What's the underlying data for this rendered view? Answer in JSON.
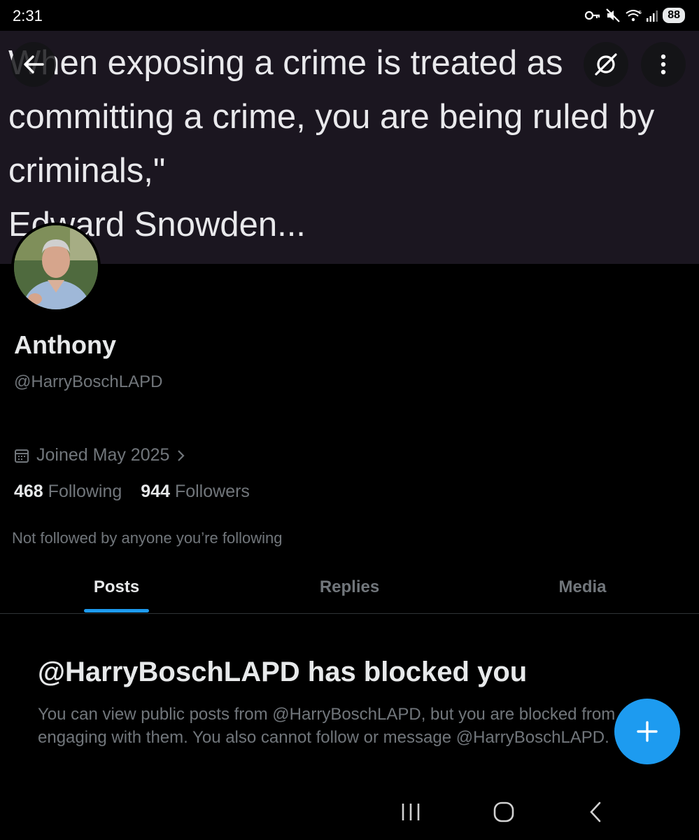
{
  "status_bar": {
    "time": "2:31",
    "battery": "88",
    "icons": [
      "vpn-key-icon",
      "mute-icon",
      "wifi-icon",
      "signal-icon",
      "battery-icon"
    ]
  },
  "banner": {
    "quote": "When exposing a crime is treated as\ncommitting a crime, you are being ruled by\ncriminals,\"\nEdward Snowden...",
    "background": "#1b1620"
  },
  "profile": {
    "display_name": "Anthony",
    "handle": "@HarryBoschLAPD",
    "joined": "Joined May 2025",
    "following_count": "468",
    "following_label": "Following",
    "followers_count": "944",
    "followers_label": "Followers",
    "not_followed": "Not followed by anyone you’re following"
  },
  "tabs": [
    {
      "label": "Posts",
      "active": true
    },
    {
      "label": "Replies",
      "active": false
    },
    {
      "label": "Media",
      "active": false
    }
  ],
  "blocked": {
    "title": "@HarryBoschLAPD has blocked you",
    "body": "You can view public posts from @HarryBoschLAPD, but you are blocked from engaging with them. You also cannot follow or message @HarryBoschLAPD."
  },
  "colors": {
    "accent": "#1d9bf0",
    "background": "#000000",
    "text_primary": "#e7e9ea",
    "text_secondary": "#71767b"
  }
}
